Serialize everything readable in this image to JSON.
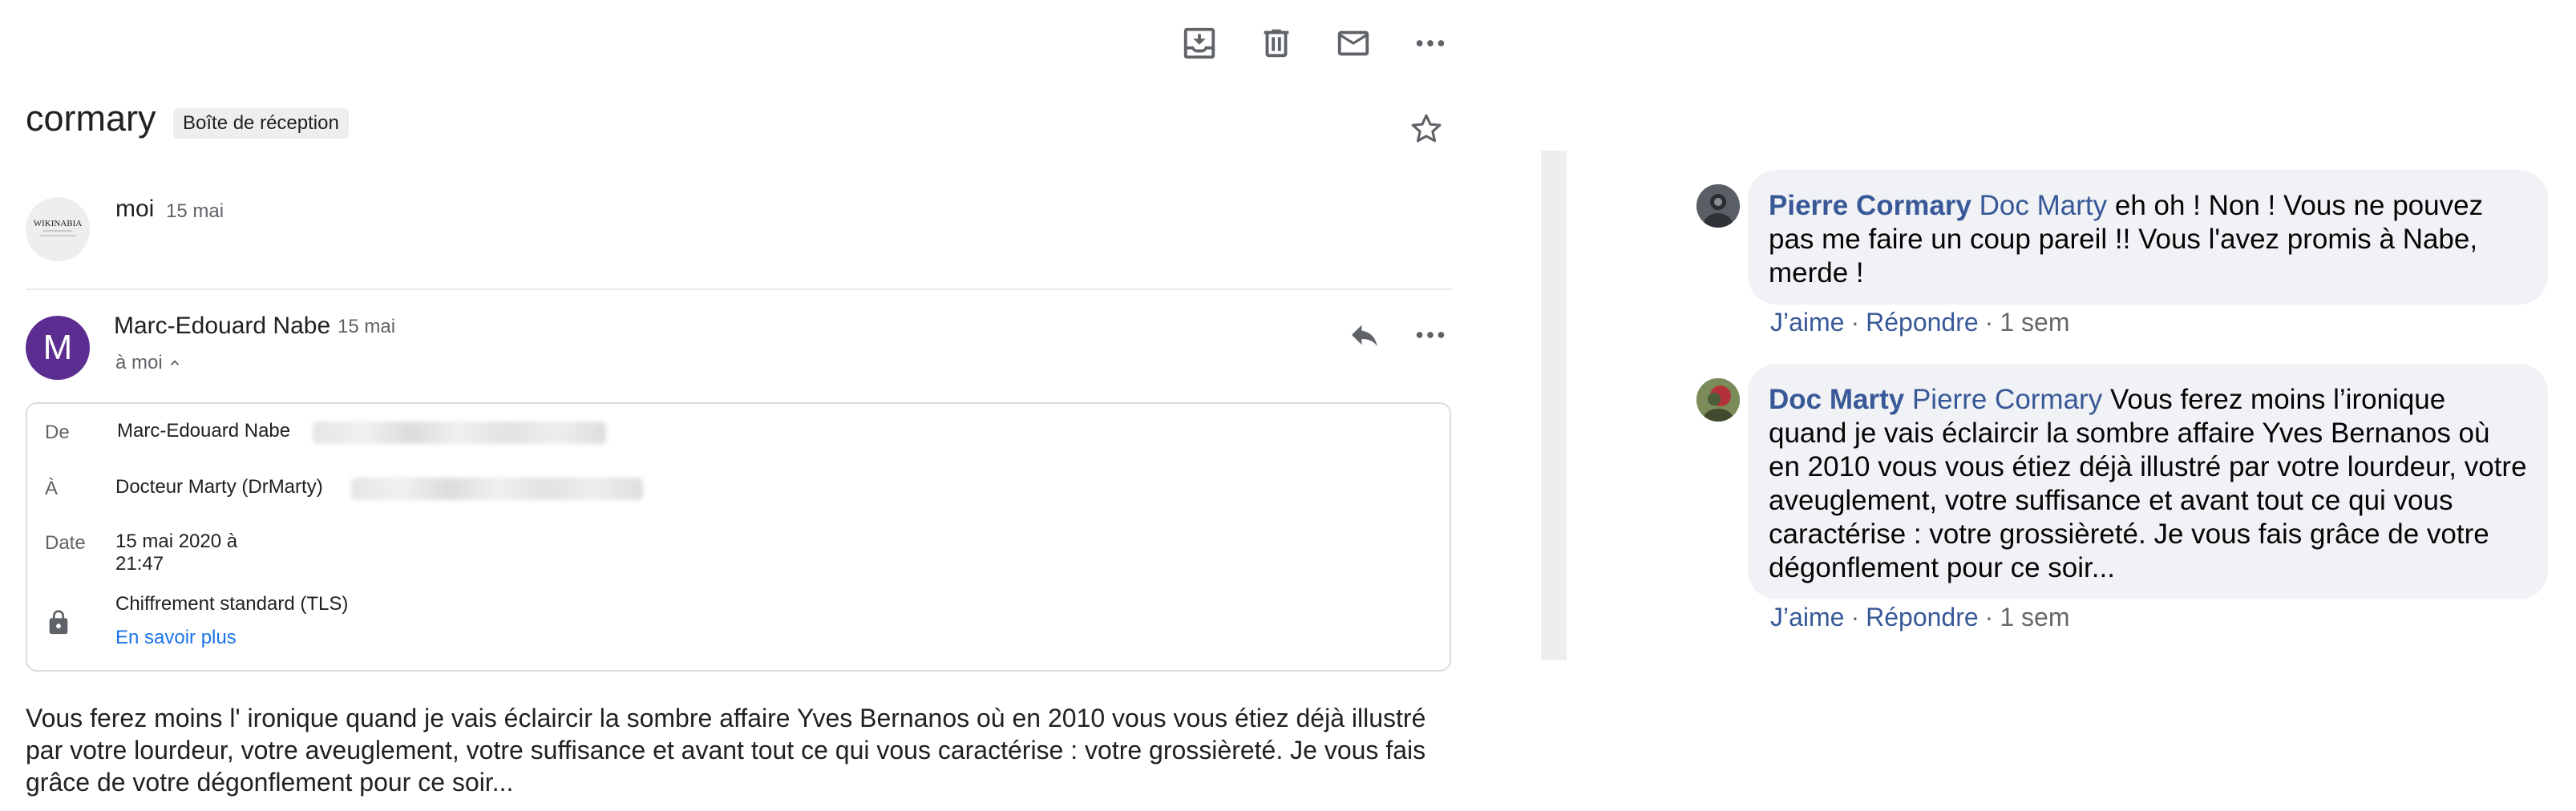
{
  "mail": {
    "toolbar": {
      "archive_icon": "archive-icon",
      "delete_icon": "trash-icon",
      "mark_unread_icon": "mail-icon",
      "more_icon": "more-horizontal-icon"
    },
    "subject": "cormary",
    "label": "Boîte de réception",
    "messages": [
      {
        "sender": "moi",
        "date": "15 mai",
        "avatar_text": "Wikinabia"
      },
      {
        "sender": "Marc-Edouard Nabe",
        "date": "15 mai",
        "avatar_letter": "M",
        "to_line": "à moi"
      }
    ],
    "details": {
      "from_label": "De",
      "from_value": "Marc-Edouard Nabe",
      "to_label": "À",
      "to_value": "Docteur Marty (DrMarty)",
      "date_label": "Date",
      "date_value_line1": "15 mai 2020 à",
      "date_value_line2": "21:47",
      "security_value": "Chiffrement standard (TLS)",
      "security_link": "En savoir plus"
    },
    "body": "Vous ferez moins l' ironique quand je vais éclaircir la sombre affaire Yves Bernanos où en 2010 vous vous étiez déjà illustré par votre lourdeur, votre aveuglement, votre suffisance et avant tout ce qui vous caractérise : votre grossièreté. Je vous fais grâce de votre dégonflement pour ce soir..."
  },
  "comments": [
    {
      "author": "Pierre Cormary",
      "tag": "Doc Marty",
      "text": " eh oh ! Non ! Vous ne pouvez pas me faire un coup pareil !! Vous l'avez promis à Nabe, merde !",
      "like": "J’aime",
      "reply": "Répondre",
      "time": "1 sem"
    },
    {
      "author": "Doc Marty",
      "tag": "Pierre Cormary",
      "text": " Vous ferez moins l’ironique quand je vais éclaircir la sombre affaire Yves Bernanos où en 2010 vous vous étiez déjà illustré par votre lourdeur, votre aveuglement, votre suffisance et avant tout ce qui vous caractérise : votre grossièreté. Je vous fais grâce de votre dégonflement pour ce soir...",
      "like": "J’aime",
      "reply": "Répondre",
      "time": "1 sem"
    }
  ],
  "colors": {
    "link_blue": "#1a73e8",
    "fb_blue": "#385898",
    "avatar_purple": "#5c2d91",
    "bubble_gray": "#f0f2f5"
  }
}
